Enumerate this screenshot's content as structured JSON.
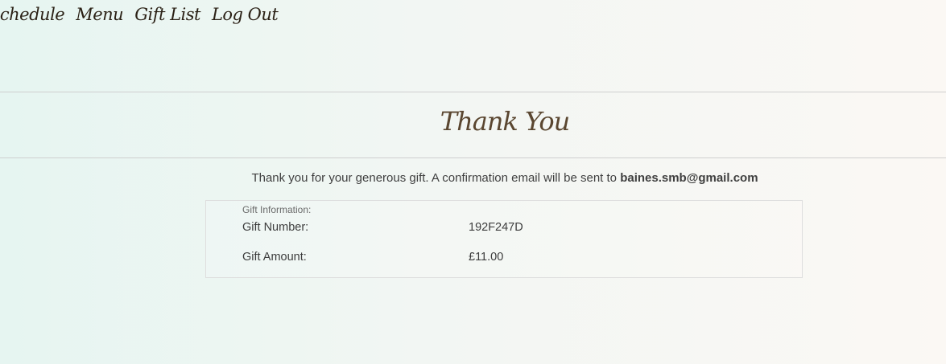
{
  "nav": {
    "items": [
      {
        "label": "Schedule"
      },
      {
        "label": "Menu"
      },
      {
        "label": "Gift List"
      },
      {
        "label": "Log Out"
      }
    ]
  },
  "page": {
    "title": "Thank You"
  },
  "message": {
    "text": "Thank you for your generous gift. A confirmation email will be sent to ",
    "email": "baines.smb@gmail.com"
  },
  "gift_info": {
    "title": "Gift Information:",
    "number_label": "Gift Number:",
    "number_value": "192F247D",
    "amount_label": "Gift Amount:",
    "amount_value": "£11.00"
  }
}
